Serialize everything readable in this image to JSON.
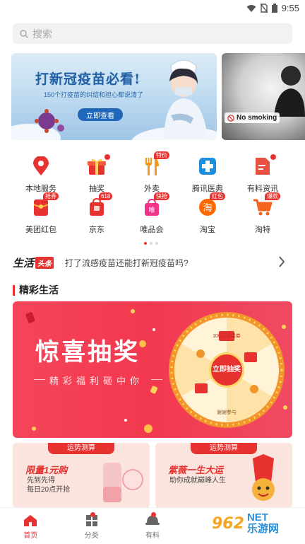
{
  "status": {
    "time": "9:55"
  },
  "search": {
    "placeholder": "搜索"
  },
  "banner": {
    "title": "打新冠疫苗必看!",
    "subtitle": "150个打疫苗的纠结和担心都说清了",
    "cta": "立即查看",
    "side_label": "No smoking"
  },
  "grid": {
    "items": [
      {
        "label": "本地服务",
        "icon": "location-pin-icon",
        "badge": ""
      },
      {
        "label": "抽奖",
        "icon": "gift-icon",
        "badge": "dot"
      },
      {
        "label": "外卖",
        "icon": "fork-knife-icon",
        "badge": "特价"
      },
      {
        "label": "腾讯医典",
        "icon": "medical-cross-icon",
        "badge": ""
      },
      {
        "label": "有料资讯",
        "icon": "news-doc-icon",
        "badge": "dot"
      },
      {
        "label": "美团红包",
        "icon": "red-packet-icon",
        "badge": "抢券"
      },
      {
        "label": "京东",
        "icon": "jd-bag-icon",
        "badge": "618"
      },
      {
        "label": "唯品会",
        "icon": "vip-bag-icon",
        "badge": "快抢"
      },
      {
        "label": "淘宝",
        "icon": "taobao-icon",
        "badge": "红包"
      },
      {
        "label": "淘特",
        "icon": "cart-icon",
        "badge": "爆款"
      }
    ]
  },
  "news": {
    "brand": "生活",
    "tag": "头条",
    "text": "打了流感疫苗还能打新冠疫苗吗?"
  },
  "section": {
    "title": "精彩生活"
  },
  "promo": {
    "title": "惊喜抽奖",
    "subtitle": "精彩福利砸中你",
    "wheel_top": "100元话费券",
    "wheel_center": "立即抽奖",
    "wheel_bottom": "谢谢参与"
  },
  "cards": [
    {
      "head": "运势测算",
      "title": "限量1元购",
      "line1": "先到先得",
      "line2": "每日20点开抢"
    },
    {
      "head": "运势测算",
      "title": "紫薇一生大运",
      "line1": "助你成就巅峰人生",
      "line2": ""
    }
  ],
  "tabbar": {
    "items": [
      {
        "label": "首页",
        "active": true
      },
      {
        "label": "分类",
        "active": false
      },
      {
        "label": "有料",
        "active": false
      }
    ]
  },
  "watermark": {
    "logo": "962",
    "site_top": "NET",
    "site_bottom": "乐游网"
  },
  "colors": {
    "accent": "#e8322f",
    "promo_bg": "#f2384f",
    "banner_blue": "#1f5fa6"
  }
}
